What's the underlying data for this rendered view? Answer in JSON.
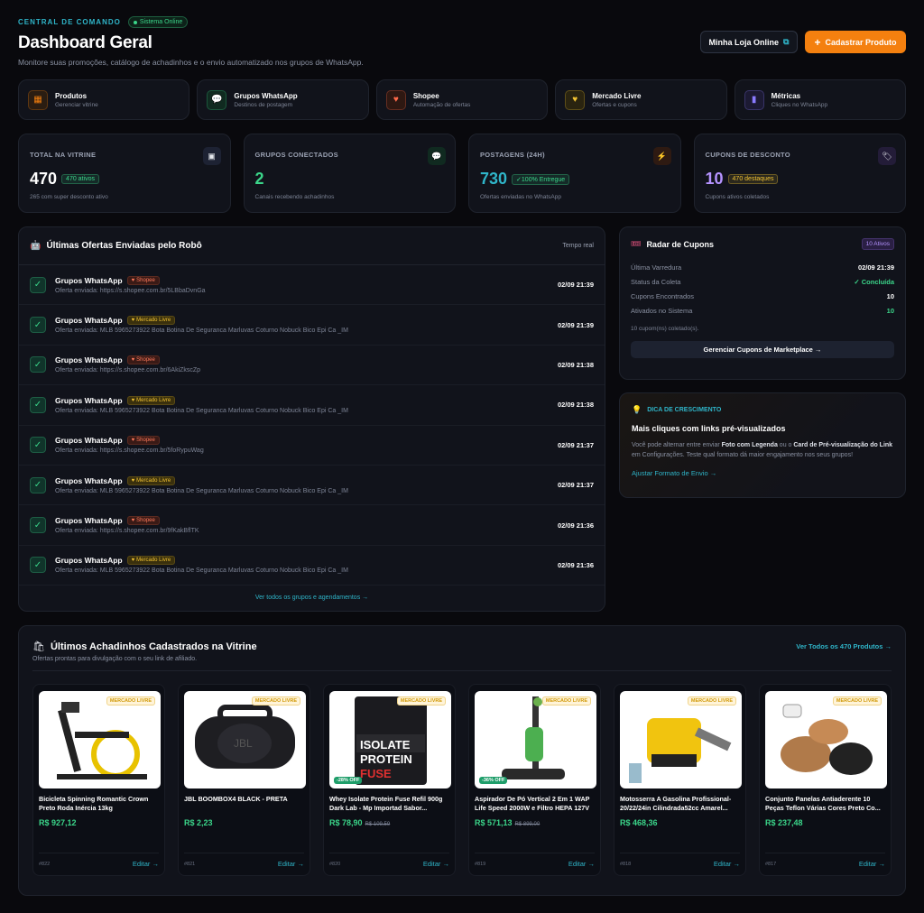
{
  "header": {
    "eyebrow": "CENTRAL DE COMANDO",
    "status": "Sistema Online",
    "title": "Dashboard Geral",
    "subtitle": "Monitore suas promoções, catálogo de achadinhos e o envio automatizado nos grupos de WhatsApp.",
    "store_button": "Minha Loja Online",
    "add_button": "Cadastrar Produto"
  },
  "nav": [
    {
      "title": "Produtos",
      "sub": "Gerenciar vitrine",
      "icon": "catalog-icon",
      "color": "#f4800f",
      "bg": "#2a1d12"
    },
    {
      "title": "Grupos WhatsApp",
      "sub": "Destinos de postagem",
      "icon": "chat-icon",
      "color": "#3bd68a",
      "bg": "#102a20"
    },
    {
      "title": "Shopee",
      "sub": "Automação de ofertas",
      "icon": "heart-icon",
      "color": "#ff6a4a",
      "bg": "#2e1812"
    },
    {
      "title": "Mercado Livre",
      "sub": "Ofertas e cupons",
      "icon": "handshake-icon",
      "color": "#f1c232",
      "bg": "#2a2410"
    },
    {
      "title": "Métricas",
      "sub": "Cliques no WhatsApp",
      "icon": "chart-icon",
      "color": "#8a7bff",
      "bg": "#1c1a33"
    }
  ],
  "stats": [
    {
      "label": "TOTAL NA VITRINE",
      "value": "470",
      "badge": "470 ativos",
      "sub": "265 com super desconto ativo",
      "color": "#ffffff",
      "badge_color": "#3bd68a",
      "icon": "box-icon",
      "icon_bg": "#1d2233"
    },
    {
      "label": "GRUPOS CONECTADOS",
      "value": "2",
      "badge": "",
      "sub": "Canais recebendo achadinhos",
      "color": "#3bd68a",
      "badge_color": "#3bd68a",
      "icon": "chat-icon",
      "icon_bg": "#102a20"
    },
    {
      "label": "POSTAGENS (24H)",
      "value": "730",
      "badge": "✓100% Entregue",
      "sub": "Ofertas enviadas no WhatsApp",
      "color": "#2fb5c9",
      "badge_color": "#3bd68a",
      "icon": "lightning-icon",
      "icon_bg": "#2e1a12"
    },
    {
      "label": "CUPONS DE DESCONTO",
      "value": "10",
      "badge": "470 destaques",
      "sub": "Cupons ativos coletados",
      "color": "#b593ff",
      "badge_color": "#f1c232",
      "icon": "ticket-icon",
      "icon_bg": "#231c38"
    }
  ],
  "offers": {
    "title": "Últimas Ofertas Enviadas pelo Robô",
    "realtime": "Tempo real",
    "footer": "Ver todos os grupos e agendamentos →",
    "rows": [
      {
        "title": "Grupos WhatsApp",
        "tag": "Shopee",
        "type": "shopee",
        "desc": "Oferta enviada: https://s.shopee.com.br/5LBbaDvnGa",
        "time": "02/09 21:39"
      },
      {
        "title": "Grupos WhatsApp",
        "tag": "Mercado Livre",
        "type": "ml",
        "desc": "Oferta enviada: MLB 5965273922 Bota Botina De Seguranca Marluvas Coturno Nobuck Bico Epi Ca _IM",
        "time": "02/09 21:39"
      },
      {
        "title": "Grupos WhatsApp",
        "tag": "Shopee",
        "type": "shopee",
        "desc": "Oferta enviada: https://s.shopee.com.br/6AkiZkscZp",
        "time": "02/09 21:38"
      },
      {
        "title": "Grupos WhatsApp",
        "tag": "Mercado Livre",
        "type": "ml",
        "desc": "Oferta enviada: MLB 5965273922 Bota Botina De Seguranca Marluvas Coturno Nobuck Bico Epi Ca _IM",
        "time": "02/09 21:38"
      },
      {
        "title": "Grupos WhatsApp",
        "tag": "Shopee",
        "type": "shopee",
        "desc": "Oferta enviada: https://s.shopee.com.br/5foRypuWag",
        "time": "02/09 21:37"
      },
      {
        "title": "Grupos WhatsApp",
        "tag": "Mercado Livre",
        "type": "ml",
        "desc": "Oferta enviada: MLB 5965273922 Bota Botina De Seguranca Marluvas Coturno Nobuck Bico Epi Ca _IM",
        "time": "02/09 21:37"
      },
      {
        "title": "Grupos WhatsApp",
        "tag": "Shopee",
        "type": "shopee",
        "desc": "Oferta enviada: https://s.shopee.com.br/9fKakBflTK",
        "time": "02/09 21:36"
      },
      {
        "title": "Grupos WhatsApp",
        "tag": "Mercado Livre",
        "type": "ml",
        "desc": "Oferta enviada: MLB 5965273922 Bota Botina De Seguranca Marluvas Coturno Nobuck Bico Epi Ca _IM",
        "time": "02/09 21:36"
      }
    ]
  },
  "radar": {
    "title": "Radar de Cupons",
    "badge": "10 Ativos",
    "rows": [
      {
        "k": "Última Varredura",
        "v": "02/09 21:39",
        "c": "#ffffff"
      },
      {
        "k": "Status da Coleta",
        "v": "✓ Concluída",
        "c": "#3bd68a"
      },
      {
        "k": "Cupons Encontrados",
        "v": "10",
        "c": "#ffffff"
      },
      {
        "k": "Ativados no Sistema",
        "v": "10",
        "c": "#3bd68a"
      }
    ],
    "note": "10 cupom(ns) coletado(s).",
    "button": "Gerenciar Cupons de Marketplace →"
  },
  "tip": {
    "eyebrow": "DICA DE CRESCIMENTO",
    "title": "Mais cliques com links pré-visualizados",
    "p1": "Você pode alternar entre enviar ",
    "b1": "Foto com Legenda",
    "p2": " ou o ",
    "b2": "Card de Pré-visualização do Link",
    "p3": " em Configurações. Teste qual formato dá maior engajamento nos seus grupos!",
    "link": "Ajustar Formato de Envio →"
  },
  "vitrine": {
    "title": "Últimos Achadinhos Cadastrados na Vitrine",
    "subtitle": "Ofertas prontas para divulgação com o seu link de afiliado.",
    "link": "Ver Todos os 470 Produtos →",
    "products": [
      {
        "name": "Bicicleta Spinning Romantic Crown Preto Roda Inércia 13kg",
        "price": "R$ 927,12",
        "old": "",
        "discount": "",
        "id": "#822",
        "tag": "MERCADO LIVRE",
        "edit": "Editar →"
      },
      {
        "name": "JBL BOOMBOX4 BLACK - PRETA",
        "price": "R$ 2,23",
        "old": "",
        "discount": "",
        "id": "#821",
        "tag": "MERCADO LIVRE",
        "edit": "Editar →"
      },
      {
        "name": "Whey Isolate Protein Fuse Refil 900g Dark Lab - Mp Importad Sabor...",
        "price": "R$ 78,90",
        "old": "R$ 109,59",
        "discount": "-28% OFF",
        "id": "#820",
        "tag": "MERCADO LIVRE",
        "edit": "Editar →"
      },
      {
        "name": "Aspirador De Pó Vertical 2 Em 1 WAP Life Speed 2000W e Filtro HEPA 127V",
        "price": "R$ 571,13",
        "old": "R$ 899,00",
        "discount": "-36% OFF",
        "id": "#819",
        "tag": "MERCADO LIVRE",
        "edit": "Editar →"
      },
      {
        "name": "Motosserra A Gasolina Profissional-20/22/24in Cilindrada52cc Amarel...",
        "price": "R$ 468,36",
        "old": "",
        "discount": "",
        "id": "#818",
        "tag": "MERCADO LIVRE",
        "edit": "Editar →"
      },
      {
        "name": "Conjunto Panelas Antiaderente 10 Peças Teflon Várias Cores Preto Co...",
        "price": "R$ 237,48",
        "old": "",
        "discount": "",
        "id": "#817",
        "tag": "MERCADO LIVRE",
        "edit": "Editar →"
      }
    ]
  }
}
